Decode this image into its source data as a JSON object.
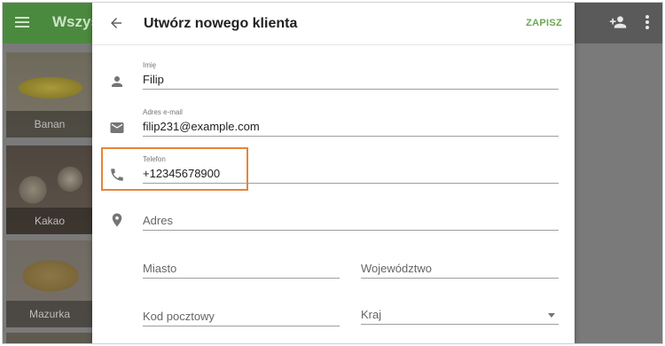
{
  "background": {
    "app_title": "Wszyst",
    "tiles": [
      "Banan",
      "Kakao",
      "Mazurka"
    ]
  },
  "dialog": {
    "title": "Utwórz nowego klienta",
    "save_label": "ZAPISZ",
    "fields": {
      "name": {
        "label": "Imię",
        "value": "Filip"
      },
      "email": {
        "label": "Adres e-mail",
        "value": "filip231@example.com"
      },
      "phone": {
        "label": "Telefon",
        "value": "+12345678900"
      },
      "address": {
        "placeholder": "Adres"
      },
      "city": {
        "placeholder": "Miasto"
      },
      "province": {
        "placeholder": "Województwo"
      },
      "postal": {
        "placeholder": "Kod pocztowy"
      },
      "country": {
        "placeholder": "Kraj"
      }
    }
  },
  "icons": {
    "back": "arrow-left-icon",
    "name": "person-icon",
    "email": "mail-icon",
    "phone": "phone-icon",
    "address": "location-pin-icon",
    "menu": "menu-icon",
    "add_person": "person-add-icon",
    "more": "more-vert-icon"
  },
  "colors": {
    "accent": "#6aa84f",
    "highlight": "#e8843a",
    "appbar": "#4a8a3e"
  }
}
